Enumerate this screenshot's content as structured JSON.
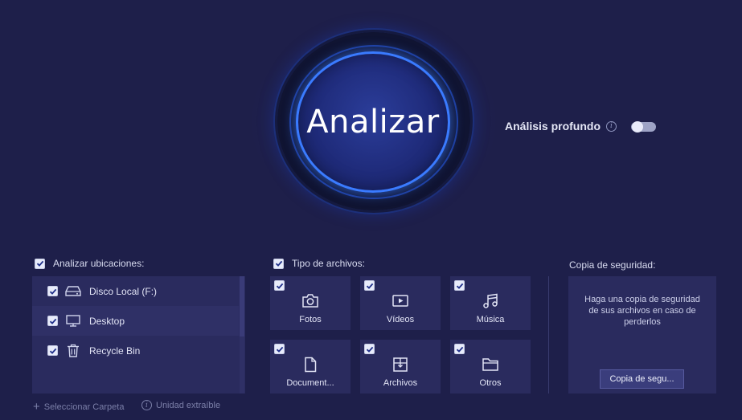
{
  "analyze": {
    "label": "Analizar"
  },
  "deep_scan": {
    "label": "Análisis profundo",
    "enabled": false
  },
  "locations": {
    "header": "Analizar ubicaciones:",
    "items": [
      {
        "label": "Disco Local (F:)",
        "icon": "hard-drive-icon",
        "checked": true
      },
      {
        "label": "Desktop",
        "icon": "monitor-icon",
        "checked": true
      },
      {
        "label": "Recycle Bin",
        "icon": "trash-icon",
        "checked": true
      }
    ],
    "select_folder": "Seleccionar Carpeta",
    "removable_drive": "Unidad extraíble"
  },
  "file_types": {
    "header": "Tipo de archivos:",
    "items": [
      {
        "label": "Fotos",
        "icon": "camera-icon",
        "checked": true
      },
      {
        "label": "Vídeos",
        "icon": "video-icon",
        "checked": true
      },
      {
        "label": "Música",
        "icon": "music-icon",
        "checked": true
      },
      {
        "label": "Document...",
        "icon": "document-icon",
        "checked": true
      },
      {
        "label": "Archivos",
        "icon": "archive-icon",
        "checked": true
      },
      {
        "label": "Otros",
        "icon": "folder-icon",
        "checked": true
      }
    ]
  },
  "backup": {
    "title": "Copia de seguridad:",
    "description": "Haga una copia de seguridad de sus archivos en caso de perderlos",
    "button": "Copia de segu..."
  },
  "colors": {
    "background": "#1e1f4a",
    "panel": "#2a2b5e",
    "accent": "#3a7bff"
  }
}
